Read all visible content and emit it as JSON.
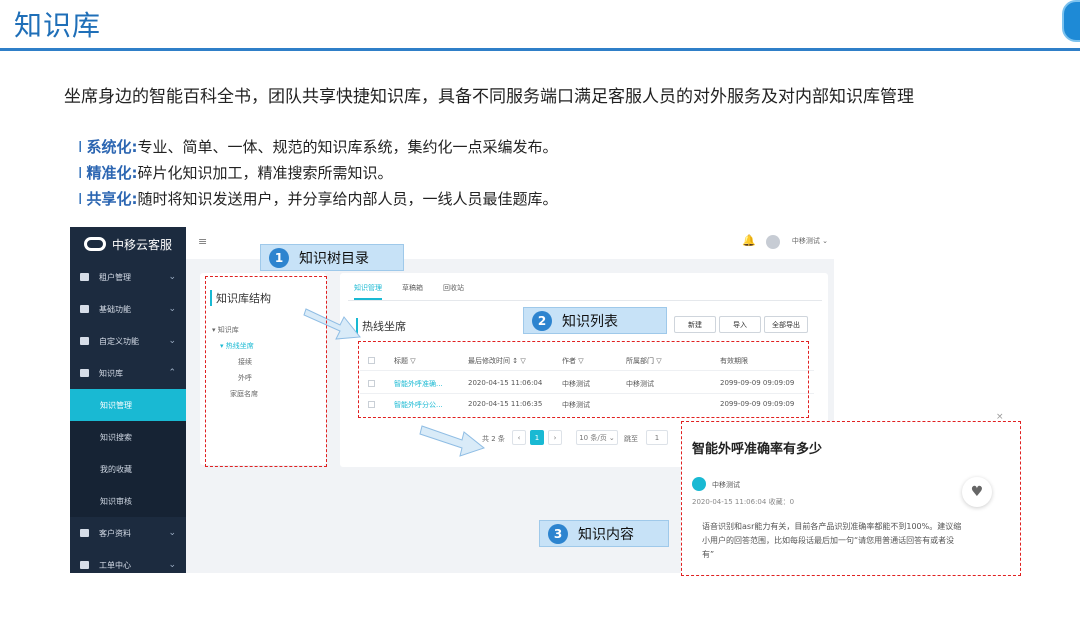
{
  "header": {
    "title": "知识库"
  },
  "intro": {
    "subtitle": "坐席身边的智能百科全书，团队共享快捷知识库，具备不同服务端口满足客服人员的对外服务及对内部知识库管理"
  },
  "bullets": [
    {
      "marker": "I",
      "key": "系统化:",
      "text": "专业、简单、一体、规范的知识库系统，集约化一点采编发布。"
    },
    {
      "marker": "I",
      "key": "精准化:",
      "text": "碎片化知识加工，精准搜索所需知识。"
    },
    {
      "marker": "I",
      "key": "共享化:",
      "text": "随时将知识发送用户，并分享给内部人员，一线人员最佳题库。"
    }
  ],
  "app": {
    "brand": "中移云客服",
    "topbar": {
      "menu_icon": "≡",
      "bell_icon": "🔔",
      "user": "中移测试 ⌄"
    },
    "sidebar": [
      {
        "label": "租户管理",
        "chev": "⌄"
      },
      {
        "label": "基础功能",
        "chev": "⌄"
      },
      {
        "label": "自定义功能",
        "chev": "⌄"
      },
      {
        "label": "知识库",
        "chev": "⌃"
      }
    ],
    "subnav": [
      "知识管理",
      "知识搜索",
      "我的收藏",
      "知识审核"
    ],
    "sidebar_bottom": [
      {
        "label": "客户资料",
        "chev": "⌄"
      },
      {
        "label": "工单中心",
        "chev": "⌄"
      }
    ],
    "tree": {
      "title": "知识库结构",
      "items": [
        "▾ 知识库",
        "▾ 热线坐席",
        "接续",
        "外呼",
        "家庭名席"
      ]
    },
    "tabs": [
      "知识管理",
      "草稿箱",
      "回收站"
    ],
    "list": {
      "title": "热线坐席",
      "buttons": [
        "新建",
        "导入",
        "全部导出"
      ],
      "columns": [
        "标题 ▽",
        "最后修改时间 ↕ ▽",
        "作者 ▽",
        "所属部门 ▽",
        "有效期限"
      ],
      "rows": [
        [
          "智能外呼准确...",
          "2020-04-15 11:06:04",
          "中移测试",
          "中移测试",
          "2099-09-09 09:09:09"
        ],
        [
          "智能外呼分公...",
          "2020-04-15 11:06:35",
          "中移测试",
          "",
          "2099-09-09 09:09:09"
        ]
      ],
      "pager": {
        "total": "共 2 条",
        "prev": "‹",
        "page": "1",
        "next": "›",
        "size": "10 条/页 ⌄",
        "goto": "跳至",
        "goto_val": "1"
      }
    }
  },
  "callouts": [
    {
      "num": "1",
      "label": "知识树目录"
    },
    {
      "num": "2",
      "label": "知识列表"
    },
    {
      "num": "3",
      "label": "知识内容"
    }
  ],
  "content": {
    "title": "智能外呼准确率有多少",
    "author": "中移测试",
    "meta": "2020-04-15 11:06:04 收藏：0",
    "body": "语音识别和asr能力有关，目前各产品识别准确率都能不到100%。建议缩小用户的回答范围，比如每段话最后加一句“请您用普通话回答有或者没有”",
    "close": "×",
    "heart": "♥"
  }
}
